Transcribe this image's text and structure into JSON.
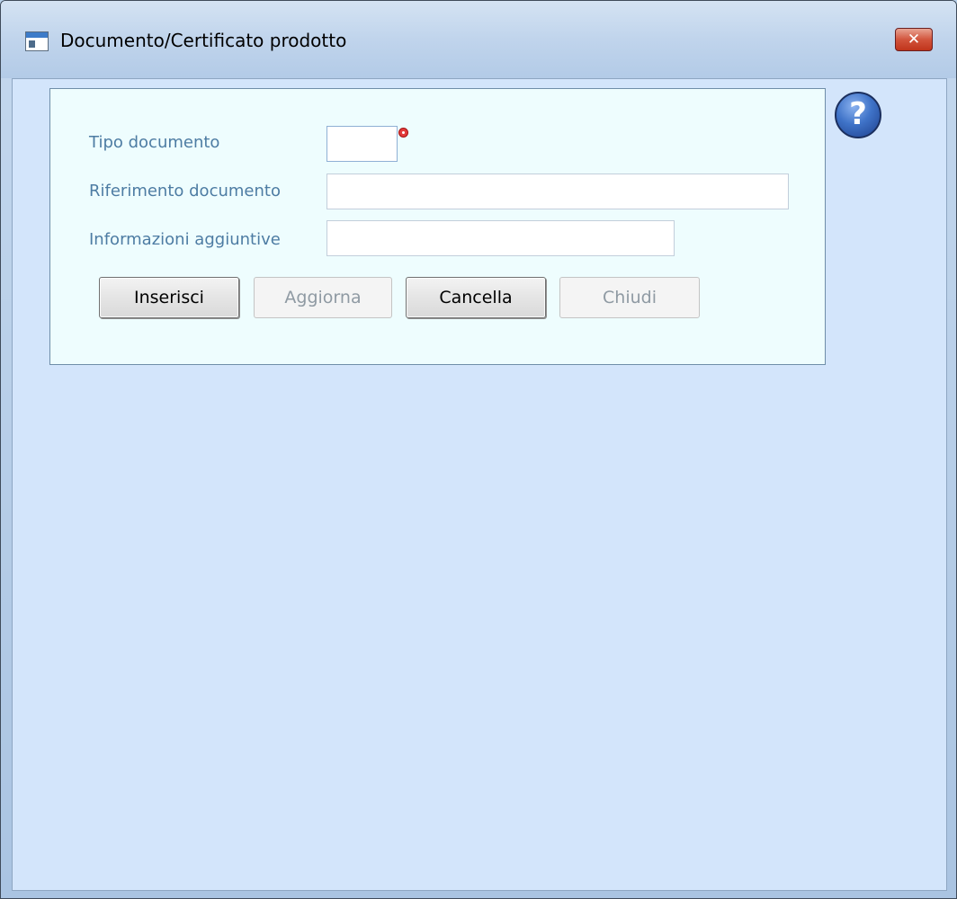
{
  "window": {
    "title": "Documento/Certificato prodotto",
    "close_glyph": "✕"
  },
  "help": {
    "glyph": "?"
  },
  "form": {
    "tipo_documento": {
      "label": "Tipo documento",
      "value": ""
    },
    "riferimento_documento": {
      "label": "Riferimento documento",
      "value": ""
    },
    "informazioni_aggiuntive": {
      "label": "Informazioni aggiuntive",
      "value": ""
    }
  },
  "buttons": {
    "inserisci": "Inserisci",
    "aggiorna": "Aggiorna",
    "cancella": "Cancella",
    "chiudi": "Chiudi"
  },
  "colors": {
    "label": "#4d7ca3",
    "client_background": "#d3e5fb",
    "group_background": "#eefdfe",
    "required_marker": "#e23b3b"
  }
}
